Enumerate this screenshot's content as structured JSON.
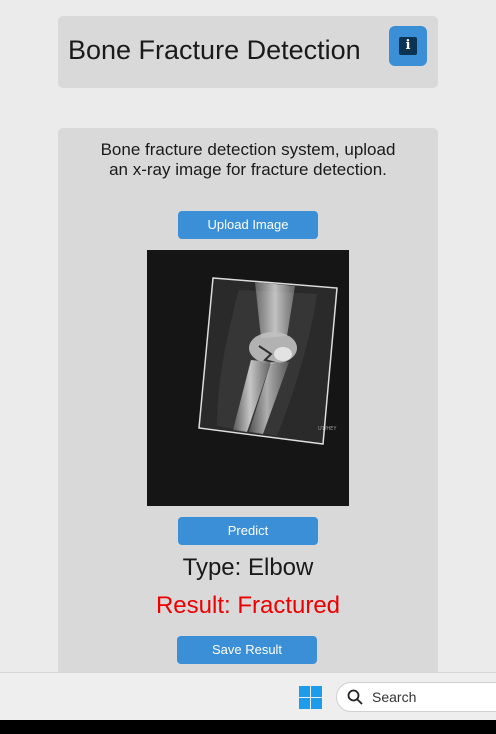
{
  "header": {
    "title": "Bone Fracture Detection",
    "info_icon": "info-icon"
  },
  "main": {
    "description": "Bone fracture detection system, upload an x-ray image for fracture detection.",
    "upload_label": "Upload Image",
    "predict_label": "Predict",
    "type_text": "Type: Elbow",
    "result_text": "Result: Fractured",
    "save_label": "Save Result",
    "image_watermark": "UT/HEY"
  },
  "taskbar": {
    "start_icon": "windows-logo-icon",
    "search_placeholder": "Search",
    "search_icon": "search-icon"
  },
  "colors": {
    "accent": "#3a8fd6",
    "result": "#ee0000",
    "panel": "#d9d9d9",
    "background": "#ebebeb"
  }
}
